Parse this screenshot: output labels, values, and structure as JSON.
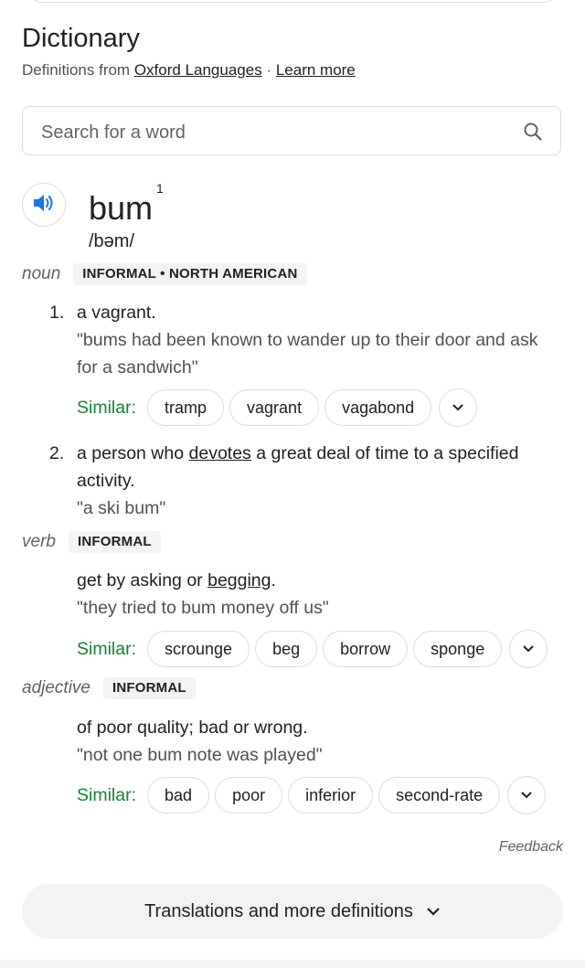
{
  "header": {
    "title": "Dictionary",
    "source_prefix": "Definitions from ",
    "source_link": "Oxford Languages",
    "separator": " · ",
    "learn_more": "Learn more"
  },
  "search": {
    "placeholder": "Search for a word",
    "value": ""
  },
  "entry": {
    "word": "bum",
    "homograph": "1",
    "phonetic": "/bəm/",
    "audio_icon": "speaker-icon"
  },
  "noun": {
    "pos": "noun",
    "label": "INFORMAL • NORTH AMERICAN",
    "senses": [
      {
        "num": "1.",
        "def": "a vagrant.",
        "example": "\"bums had been known to wander up to their door and ask for a sandwich\"",
        "similar_label": "Similar:",
        "similar": [
          "tramp",
          "vagrant",
          "vagabond"
        ]
      },
      {
        "num": "2.",
        "def_before": "a person who ",
        "def_link": "devotes",
        "def_after": " a great deal of time to a specified activity.",
        "example": "\"a ski bum\""
      }
    ]
  },
  "verb": {
    "pos": "verb",
    "label": "INFORMAL",
    "def_before": "get by asking or ",
    "def_link": "begging",
    "def_after": ".",
    "example": "\"they tried to bum money off us\"",
    "similar_label": "Similar:",
    "similar": [
      "scrounge",
      "beg",
      "borrow",
      "sponge"
    ]
  },
  "adjective": {
    "pos": "adjective",
    "label": "INFORMAL",
    "def": "of poor quality; bad or wrong.",
    "example": "\"not one bum note was played\"",
    "similar_label": "Similar:",
    "similar": [
      "bad",
      "poor",
      "inferior",
      "second-rate"
    ]
  },
  "footer": {
    "feedback": "Feedback",
    "more_button": "Translations and more definitions"
  },
  "colors": {
    "accent_blue": "#1a73e8",
    "similar_green": "#188038",
    "text": "#202124",
    "muted": "#5f6368"
  }
}
